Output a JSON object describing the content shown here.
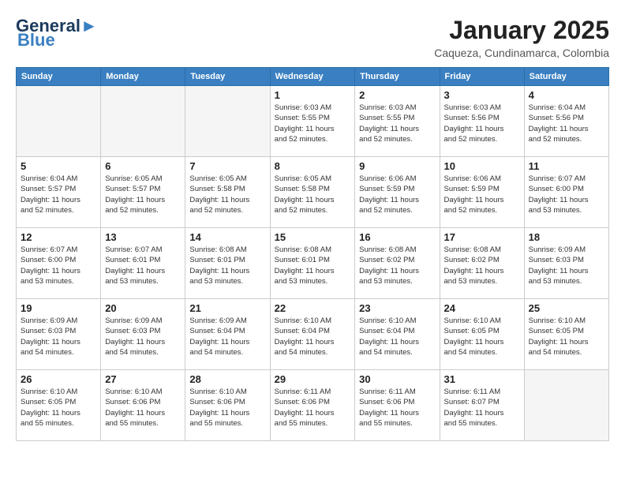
{
  "logo": {
    "line1": "General",
    "line2": "Blue"
  },
  "title": "January 2025",
  "location": "Caqueza, Cundinamarca, Colombia",
  "weekdays": [
    "Sunday",
    "Monday",
    "Tuesday",
    "Wednesday",
    "Thursday",
    "Friday",
    "Saturday"
  ],
  "weeks": [
    [
      {
        "day": "",
        "info": ""
      },
      {
        "day": "",
        "info": ""
      },
      {
        "day": "",
        "info": ""
      },
      {
        "day": "1",
        "info": "Sunrise: 6:03 AM\nSunset: 5:55 PM\nDaylight: 11 hours\nand 52 minutes."
      },
      {
        "day": "2",
        "info": "Sunrise: 6:03 AM\nSunset: 5:55 PM\nDaylight: 11 hours\nand 52 minutes."
      },
      {
        "day": "3",
        "info": "Sunrise: 6:03 AM\nSunset: 5:56 PM\nDaylight: 11 hours\nand 52 minutes."
      },
      {
        "day": "4",
        "info": "Sunrise: 6:04 AM\nSunset: 5:56 PM\nDaylight: 11 hours\nand 52 minutes."
      }
    ],
    [
      {
        "day": "5",
        "info": "Sunrise: 6:04 AM\nSunset: 5:57 PM\nDaylight: 11 hours\nand 52 minutes."
      },
      {
        "day": "6",
        "info": "Sunrise: 6:05 AM\nSunset: 5:57 PM\nDaylight: 11 hours\nand 52 minutes."
      },
      {
        "day": "7",
        "info": "Sunrise: 6:05 AM\nSunset: 5:58 PM\nDaylight: 11 hours\nand 52 minutes."
      },
      {
        "day": "8",
        "info": "Sunrise: 6:05 AM\nSunset: 5:58 PM\nDaylight: 11 hours\nand 52 minutes."
      },
      {
        "day": "9",
        "info": "Sunrise: 6:06 AM\nSunset: 5:59 PM\nDaylight: 11 hours\nand 52 minutes."
      },
      {
        "day": "10",
        "info": "Sunrise: 6:06 AM\nSunset: 5:59 PM\nDaylight: 11 hours\nand 52 minutes."
      },
      {
        "day": "11",
        "info": "Sunrise: 6:07 AM\nSunset: 6:00 PM\nDaylight: 11 hours\nand 53 minutes."
      }
    ],
    [
      {
        "day": "12",
        "info": "Sunrise: 6:07 AM\nSunset: 6:00 PM\nDaylight: 11 hours\nand 53 minutes."
      },
      {
        "day": "13",
        "info": "Sunrise: 6:07 AM\nSunset: 6:01 PM\nDaylight: 11 hours\nand 53 minutes."
      },
      {
        "day": "14",
        "info": "Sunrise: 6:08 AM\nSunset: 6:01 PM\nDaylight: 11 hours\nand 53 minutes."
      },
      {
        "day": "15",
        "info": "Sunrise: 6:08 AM\nSunset: 6:01 PM\nDaylight: 11 hours\nand 53 minutes."
      },
      {
        "day": "16",
        "info": "Sunrise: 6:08 AM\nSunset: 6:02 PM\nDaylight: 11 hours\nand 53 minutes."
      },
      {
        "day": "17",
        "info": "Sunrise: 6:08 AM\nSunset: 6:02 PM\nDaylight: 11 hours\nand 53 minutes."
      },
      {
        "day": "18",
        "info": "Sunrise: 6:09 AM\nSunset: 6:03 PM\nDaylight: 11 hours\nand 53 minutes."
      }
    ],
    [
      {
        "day": "19",
        "info": "Sunrise: 6:09 AM\nSunset: 6:03 PM\nDaylight: 11 hours\nand 54 minutes."
      },
      {
        "day": "20",
        "info": "Sunrise: 6:09 AM\nSunset: 6:03 PM\nDaylight: 11 hours\nand 54 minutes."
      },
      {
        "day": "21",
        "info": "Sunrise: 6:09 AM\nSunset: 6:04 PM\nDaylight: 11 hours\nand 54 minutes."
      },
      {
        "day": "22",
        "info": "Sunrise: 6:10 AM\nSunset: 6:04 PM\nDaylight: 11 hours\nand 54 minutes."
      },
      {
        "day": "23",
        "info": "Sunrise: 6:10 AM\nSunset: 6:04 PM\nDaylight: 11 hours\nand 54 minutes."
      },
      {
        "day": "24",
        "info": "Sunrise: 6:10 AM\nSunset: 6:05 PM\nDaylight: 11 hours\nand 54 minutes."
      },
      {
        "day": "25",
        "info": "Sunrise: 6:10 AM\nSunset: 6:05 PM\nDaylight: 11 hours\nand 54 minutes."
      }
    ],
    [
      {
        "day": "26",
        "info": "Sunrise: 6:10 AM\nSunset: 6:05 PM\nDaylight: 11 hours\nand 55 minutes."
      },
      {
        "day": "27",
        "info": "Sunrise: 6:10 AM\nSunset: 6:06 PM\nDaylight: 11 hours\nand 55 minutes."
      },
      {
        "day": "28",
        "info": "Sunrise: 6:10 AM\nSunset: 6:06 PM\nDaylight: 11 hours\nand 55 minutes."
      },
      {
        "day": "29",
        "info": "Sunrise: 6:11 AM\nSunset: 6:06 PM\nDaylight: 11 hours\nand 55 minutes."
      },
      {
        "day": "30",
        "info": "Sunrise: 6:11 AM\nSunset: 6:06 PM\nDaylight: 11 hours\nand 55 minutes."
      },
      {
        "day": "31",
        "info": "Sunrise: 6:11 AM\nSunset: 6:07 PM\nDaylight: 11 hours\nand 55 minutes."
      },
      {
        "day": "",
        "info": ""
      }
    ]
  ]
}
